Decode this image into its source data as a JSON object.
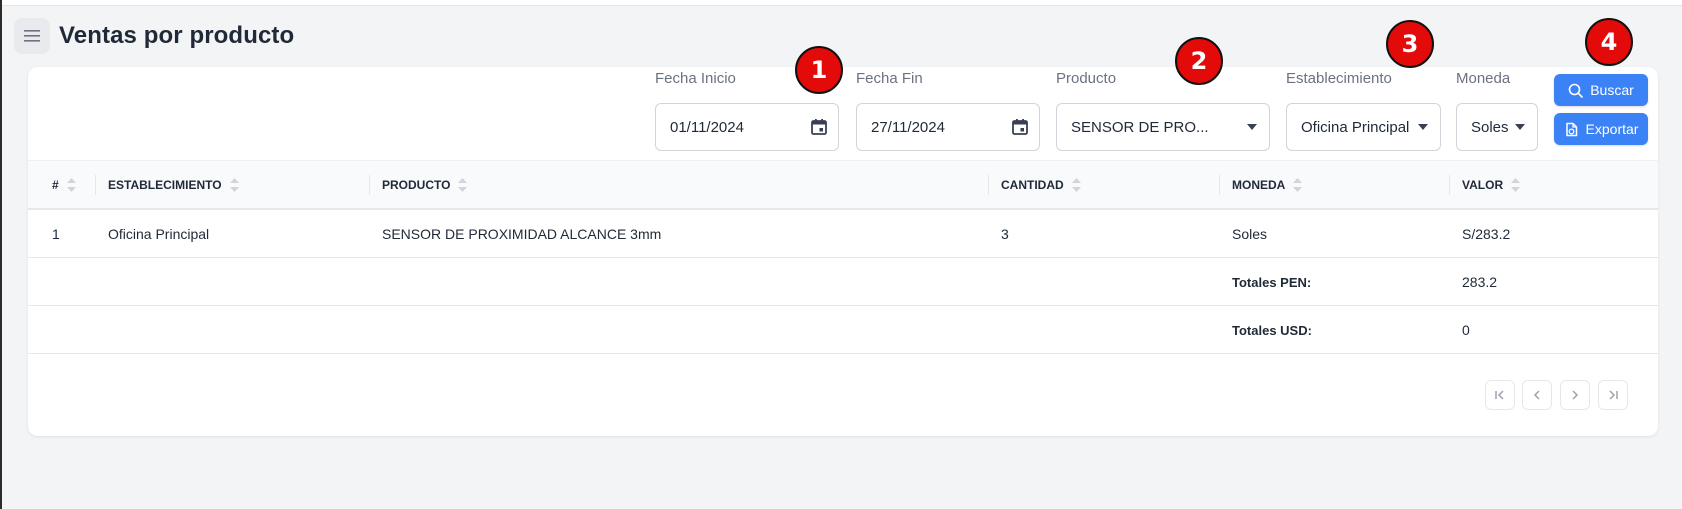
{
  "page": {
    "title": "Ventas por producto"
  },
  "filters": {
    "fecha_inicio": {
      "label": "Fecha Inicio",
      "value": "01/11/2024"
    },
    "fecha_fin": {
      "label": "Fecha Fin",
      "value": "27/11/2024"
    },
    "producto": {
      "label": "Producto",
      "value": "SENSOR DE PRO..."
    },
    "establecimiento": {
      "label": "Establecimiento",
      "value": "Oficina Principal"
    },
    "moneda": {
      "label": "Moneda",
      "value": "Soles"
    },
    "buscar_label": "Buscar",
    "exportar_label": "Exportar"
  },
  "table": {
    "columns": [
      "#",
      "ESTABLECIMIENTO",
      "PRODUCTO",
      "CANTIDAD",
      "MONEDA",
      "VALOR"
    ],
    "rows": [
      {
        "num": "1",
        "establecimiento": "Oficina Principal",
        "producto": "SENSOR DE PROXIMIDAD ALCANCE 3mm",
        "cantidad": "3",
        "moneda": "Soles",
        "valor": "S/283.2"
      }
    ],
    "totals": [
      {
        "label": "Totales PEN:",
        "value": "283.2"
      },
      {
        "label": "Totales USD:",
        "value": "0"
      }
    ]
  },
  "annotations": [
    "1",
    "2",
    "3",
    "4"
  ],
  "colors": {
    "primary": "#3b82f6",
    "annotation": "#e30a0a",
    "background": "#f3f4f6"
  },
  "icons": [
    "menu-icon",
    "calendar-icon",
    "caret-down-icon",
    "search-icon",
    "export-icon",
    "sort-icon",
    "first-page-icon",
    "prev-page-icon",
    "next-page-icon",
    "last-page-icon"
  ]
}
